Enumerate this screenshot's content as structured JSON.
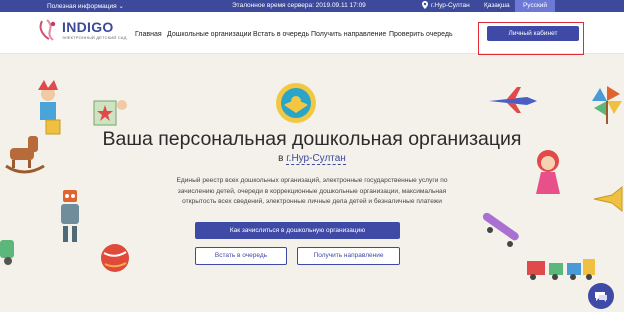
{
  "topbar": {
    "info_label": "Полезная информация ⌄",
    "server_time": "Эталонное время сервера: 2019.09.11 17:09",
    "city": "г.Нур-Султан",
    "lang_kz": "Қазақша",
    "lang_ru": "Русский"
  },
  "logo": {
    "title": "INDIGO",
    "subtitle": "ЭЛЕКТРОННЫЙ ДЕТСКИЙ САД"
  },
  "nav": {
    "items": [
      "Главная",
      "Дошкольные организации",
      "Встать в очередь",
      "Получить направление",
      "Проверить очередь"
    ],
    "cabinet_button": "Личный кабинет"
  },
  "hero": {
    "title": "Ваша персональная дошкольная организация",
    "city_prefix": "в",
    "city": "г.Нур-Султан",
    "description": "Единый реестр всех дошкольных организаций, электронные государственные услуги по зачислению детей, очереди в коррекционные дошкольные организации, максимальная открытость всех сведений, электронные личные дела детей и безналичные платежи",
    "primary_button": "Как зачислиться в дошкольную организацию",
    "queue_button": "Встать в очередь",
    "direction_button": "Получить направление"
  },
  "colors": {
    "brand": "#3d4a9c",
    "button": "#3f4aa6",
    "highlight": "#e02a36",
    "background": "#f3f1ea"
  },
  "icons": [
    "location-pin-icon",
    "logo-icon",
    "emblem-icon",
    "chat-icon"
  ]
}
